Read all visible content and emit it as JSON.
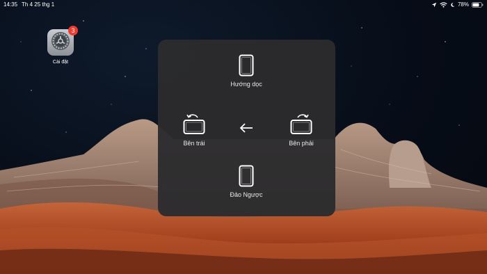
{
  "statusbar": {
    "time": "14:35",
    "date": "Th 4 25 thg 1",
    "battery": "78%",
    "icons": [
      "location-icon",
      "wifi-icon",
      "moon-icon",
      "battery-icon"
    ]
  },
  "home": {
    "app": {
      "label": "Cài đặt",
      "badge": "3",
      "icon": "gear-icon"
    }
  },
  "rotate_menu": {
    "portrait": "Hướng dọc",
    "left": "Bên trái",
    "right": "Bên phải",
    "upside_down": "Đảo Ngược",
    "back_icon": "back-arrow-icon"
  },
  "colors": {
    "panel": "#2c2c2e",
    "badge": "#ee3b30",
    "text": "#e9e9ea"
  }
}
